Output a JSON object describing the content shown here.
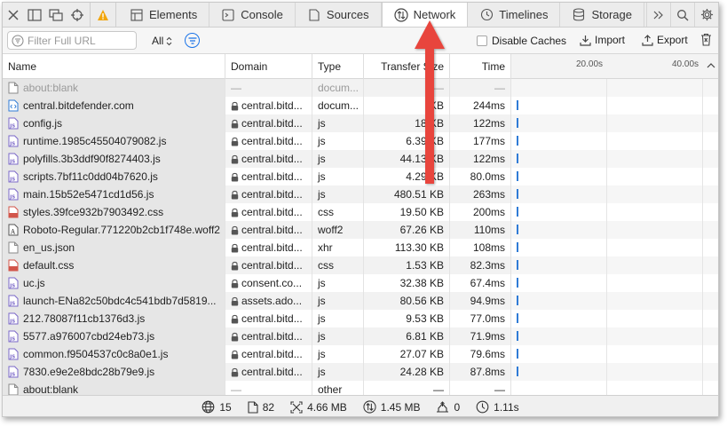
{
  "tabs": [
    {
      "label": "Elements",
      "icon": "elements-icon"
    },
    {
      "label": "Console",
      "icon": "console-icon"
    },
    {
      "label": "Sources",
      "icon": "sources-icon"
    },
    {
      "label": "Network",
      "icon": "network-icon",
      "selected": true
    },
    {
      "label": "Timelines",
      "icon": "timelines-icon"
    },
    {
      "label": "Storage",
      "icon": "storage-icon"
    }
  ],
  "filter": {
    "placeholder": "Filter Full URL",
    "type_select": "All",
    "disable_caches_label": "Disable Caches",
    "import_label": "Import",
    "export_label": "Export"
  },
  "columns": {
    "name": "Name",
    "domain": "Domain",
    "type": "Type",
    "transfer_size": "Transfer Size",
    "time": "Time"
  },
  "waterfall_ticks": [
    "20.00s",
    "40.00s"
  ],
  "rows": [
    {
      "name": "about:blank",
      "domain": "—",
      "type": "docum...",
      "size": "—",
      "time": "—",
      "icon": "blank-doc-icon",
      "secure": false,
      "dim": true
    },
    {
      "name": "central.bitdefender.com",
      "domain": "central.bitd...",
      "type": "docum...",
      "size": "KB",
      "time": "244ms",
      "icon": "html-doc-icon",
      "secure": true
    },
    {
      "name": "config.js",
      "domain": "central.bitd...",
      "type": "js",
      "size": "18 KB",
      "time": "122ms",
      "icon": "js-file-icon",
      "secure": true
    },
    {
      "name": "runtime.1985c45504079082.js",
      "domain": "central.bitd...",
      "type": "js",
      "size": "6.39 KB",
      "time": "177ms",
      "icon": "js-file-icon",
      "secure": true
    },
    {
      "name": "polyfills.3b3ddf90f8274403.js",
      "domain": "central.bitd...",
      "type": "js",
      "size": "44.13 KB",
      "time": "122ms",
      "icon": "js-file-icon",
      "secure": true
    },
    {
      "name": "scripts.7bf11c0dd04b7620.js",
      "domain": "central.bitd...",
      "type": "js",
      "size": "4.29 KB",
      "time": "80.0ms",
      "icon": "js-file-icon",
      "secure": true
    },
    {
      "name": "main.15b52e5471cd1d56.js",
      "domain": "central.bitd...",
      "type": "js",
      "size": "480.51 KB",
      "time": "263ms",
      "icon": "js-file-icon",
      "secure": true
    },
    {
      "name": "styles.39fce932b7903492.css",
      "domain": "central.bitd...",
      "type": "css",
      "size": "19.50 KB",
      "time": "200ms",
      "icon": "css-file-icon",
      "secure": true
    },
    {
      "name": "Roboto-Regular.771220b2cb1f748e.woff2",
      "domain": "central.bitd...",
      "type": "woff2",
      "size": "67.26 KB",
      "time": "110ms",
      "icon": "font-file-icon",
      "secure": true
    },
    {
      "name": "en_us.json",
      "domain": "central.bitd...",
      "type": "xhr",
      "size": "113.30 KB",
      "time": "108ms",
      "icon": "blank-doc-icon",
      "secure": true
    },
    {
      "name": "default.css",
      "domain": "central.bitd...",
      "type": "css",
      "size": "1.53 KB",
      "time": "82.3ms",
      "icon": "css-file-icon",
      "secure": true
    },
    {
      "name": "uc.js",
      "domain": "consent.co...",
      "type": "js",
      "size": "32.38 KB",
      "time": "67.4ms",
      "icon": "js-file-icon",
      "secure": true
    },
    {
      "name": "launch-ENa82c50bdc4c541bdb7d5819...",
      "domain": "assets.ado...",
      "type": "js",
      "size": "80.56 KB",
      "time": "94.9ms",
      "icon": "js-file-icon",
      "secure": true
    },
    {
      "name": "212.78087f11cb1376d3.js",
      "domain": "central.bitd...",
      "type": "js",
      "size": "9.53 KB",
      "time": "77.0ms",
      "icon": "js-file-icon",
      "secure": true
    },
    {
      "name": "5577.a976007cbd24eb73.js",
      "domain": "central.bitd...",
      "type": "js",
      "size": "6.81 KB",
      "time": "71.9ms",
      "icon": "js-file-icon",
      "secure": true
    },
    {
      "name": "common.f9504537c0c8a0e1.js",
      "domain": "central.bitd...",
      "type": "js",
      "size": "27.07 KB",
      "time": "79.6ms",
      "icon": "js-file-icon",
      "secure": true
    },
    {
      "name": "7830.e9e2e8bdc28b79e9.js",
      "domain": "central.bitd...",
      "type": "js",
      "size": "24.28 KB",
      "time": "87.8ms",
      "icon": "js-file-icon",
      "secure": true
    },
    {
      "name": "about:blank",
      "domain": "—",
      "type": "other",
      "size": "—",
      "time": "—",
      "icon": "blank-doc-icon",
      "secure": false
    }
  ],
  "status": {
    "domains": "15",
    "resources": "82",
    "resource_size": "4.66 MB",
    "transferred": "1.45 MB",
    "redirects": "0",
    "load_time": "1.11s"
  },
  "colors": {
    "accent": "#1a73e8",
    "annotation_arrow": "#e8453c",
    "waterfall_bar": "#2f7bd6",
    "warning": "#f2a60d"
  }
}
